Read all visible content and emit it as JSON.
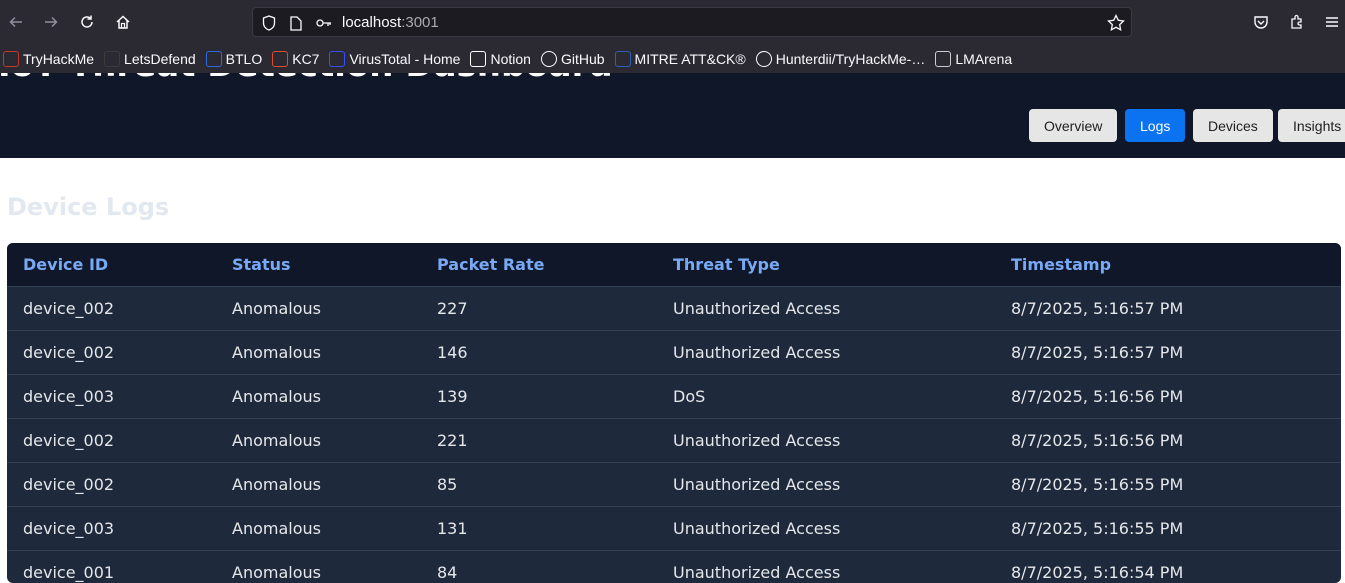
{
  "browser": {
    "url_host": "localhost",
    "url_port": ":3001"
  },
  "bookmarks": [
    {
      "label": "TryHackMe",
      "icon": "tryhackme-icon",
      "color": "#c0392b"
    },
    {
      "label": "LetsDefend",
      "icon": "letsdefend-icon",
      "color": "#3b3b3b"
    },
    {
      "label": "BTLO",
      "icon": "btlo-icon",
      "color": "#2d6cdf"
    },
    {
      "label": "KC7",
      "icon": "kc7-icon",
      "color": "#e04b2b"
    },
    {
      "label": "VirusTotal - Home",
      "icon": "virustotal-icon",
      "color": "#394eff"
    },
    {
      "label": "Notion",
      "icon": "notion-icon",
      "color": "#ffffff"
    },
    {
      "label": "GitHub",
      "icon": "github-icon",
      "color": "#ffffff"
    },
    {
      "label": "MITRE ATT&CK®",
      "icon": "mitre-icon",
      "color": "#2f5fb3"
    },
    {
      "label": "Hunterdii/TryHackMe-…",
      "icon": "github-icon",
      "color": "#ffffff"
    },
    {
      "label": "LMArena",
      "icon": "grid-icon",
      "color": "#cccccc"
    }
  ],
  "header": {
    "title": "IoT Threat Detection Dashboard",
    "nav": [
      {
        "label": "Overview",
        "active": false
      },
      {
        "label": "Logs",
        "active": true
      },
      {
        "label": "Devices",
        "active": false
      },
      {
        "label": "Insights",
        "active": false
      }
    ]
  },
  "main": {
    "section_title": "Device Logs",
    "columns": [
      "Device ID",
      "Status",
      "Packet Rate",
      "Threat Type",
      "Timestamp"
    ],
    "rows": [
      [
        "device_002",
        "Anomalous",
        "227",
        "Unauthorized Access",
        "8/7/2025, 5:16:57 PM"
      ],
      [
        "device_002",
        "Anomalous",
        "146",
        "Unauthorized Access",
        "8/7/2025, 5:16:57 PM"
      ],
      [
        "device_003",
        "Anomalous",
        "139",
        "DoS",
        "8/7/2025, 5:16:56 PM"
      ],
      [
        "device_002",
        "Anomalous",
        "221",
        "Unauthorized Access",
        "8/7/2025, 5:16:56 PM"
      ],
      [
        "device_002",
        "Anomalous",
        "85",
        "Unauthorized Access",
        "8/7/2025, 5:16:55 PM"
      ],
      [
        "device_003",
        "Anomalous",
        "131",
        "Unauthorized Access",
        "8/7/2025, 5:16:55 PM"
      ],
      [
        "device_001",
        "Anomalous",
        "84",
        "Unauthorized Access",
        "8/7/2025, 5:16:54 PM"
      ]
    ]
  }
}
